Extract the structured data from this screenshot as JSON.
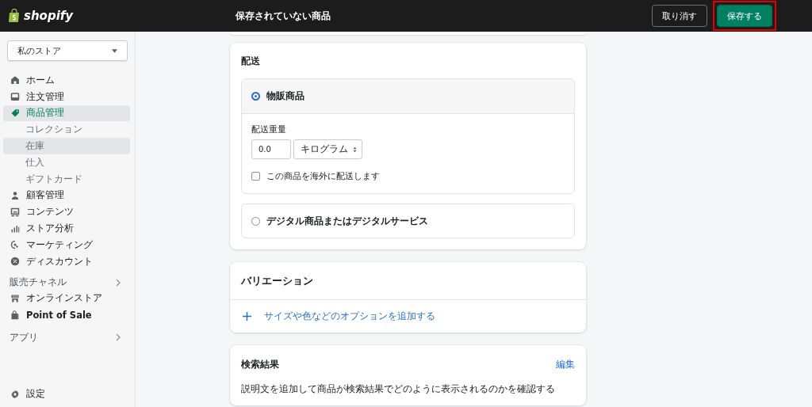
{
  "topbar": {
    "logo": "shopify",
    "title": "保存されていない商品",
    "buttons": [
      {
        "label": "取り消す",
        "kind": "secondary"
      },
      {
        "label": "保存する",
        "kind": "primary",
        "highlighted": true
      }
    ]
  },
  "sidebar": {
    "store": "私のストア",
    "items": [
      {
        "label": "ホーム",
        "selected": false
      },
      {
        "label": "注文管理",
        "selected": false
      },
      {
        "label": "商品管理",
        "selected": true,
        "children": [
          {
            "label": "コレクション",
            "hovered": false
          },
          {
            "label": "在庫",
            "hovered": true
          },
          {
            "label": "仕入",
            "hovered": false
          },
          {
            "label": "ギフトカード",
            "hovered": false
          }
        ]
      },
      {
        "label": "顧客管理",
        "selected": false
      },
      {
        "label": "コンテンツ",
        "selected": false
      },
      {
        "label": "ストア分析",
        "selected": false
      },
      {
        "label": "マーケティング",
        "selected": false
      },
      {
        "label": "ディスカウント",
        "selected": false
      }
    ],
    "channels": {
      "title": "販売チャネル",
      "items": [
        {
          "label": "オンラインストア",
          "selected": false
        },
        {
          "label": "Point of Sale",
          "selected": false
        }
      ]
    },
    "apps": {
      "title": "アプリ"
    },
    "settings": "設定"
  },
  "shipping": {
    "title": "配送",
    "options": [
      {
        "label": "物販商品",
        "selected": true,
        "weight_label": "配送重量",
        "weight": "0.0",
        "unit": "キログラム",
        "international_label": "この商品を海外に配送します",
        "international": false
      },
      {
        "label": "デジタル商品またはデジタルサービス",
        "selected": false
      }
    ]
  },
  "variations": {
    "title": "バリエーション",
    "add_link": "サイズや色などのオプションを追加する"
  },
  "seo": {
    "title": "検索結果",
    "edit_link": "編集",
    "description": "説明文を追加して商品が検索結果でどのように表示されるのかを確認する"
  }
}
